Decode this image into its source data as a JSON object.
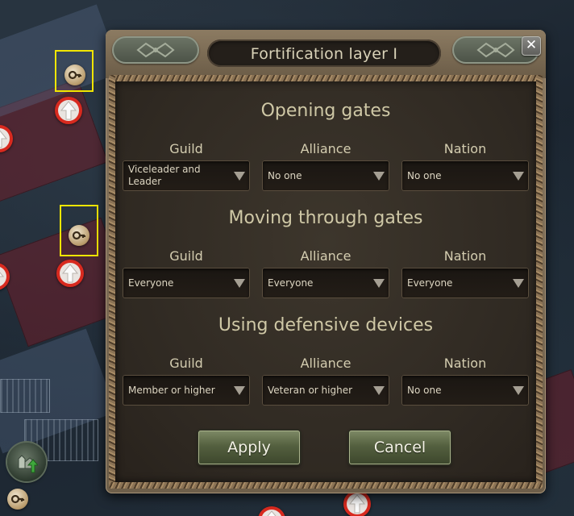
{
  "dialog": {
    "title": "Fortification layer I",
    "close_icon": "close-icon",
    "sections": [
      {
        "title": "Opening gates",
        "columns": [
          {
            "label": "Guild",
            "value": "Viceleader and Leader"
          },
          {
            "label": "Alliance",
            "value": "No one"
          },
          {
            "label": "Nation",
            "value": "No one"
          }
        ]
      },
      {
        "title": "Moving through gates",
        "columns": [
          {
            "label": "Guild",
            "value": "Everyone"
          },
          {
            "label": "Alliance",
            "value": "Everyone"
          },
          {
            "label": "Nation",
            "value": "Everyone"
          }
        ]
      },
      {
        "title": "Using defensive devices",
        "columns": [
          {
            "label": "Guild",
            "value": "Member or higher"
          },
          {
            "label": "Alliance",
            "value": "Veteran or higher"
          },
          {
            "label": "Nation",
            "value": "No one"
          }
        ]
      }
    ],
    "buttons": {
      "apply": "Apply",
      "cancel": "Cancel"
    }
  },
  "map": {
    "markers": {
      "gate_key": "key-icon",
      "upgrade": "up-arrow-icon",
      "home": "town-icon"
    },
    "highlight_color": "#f2e600"
  }
}
